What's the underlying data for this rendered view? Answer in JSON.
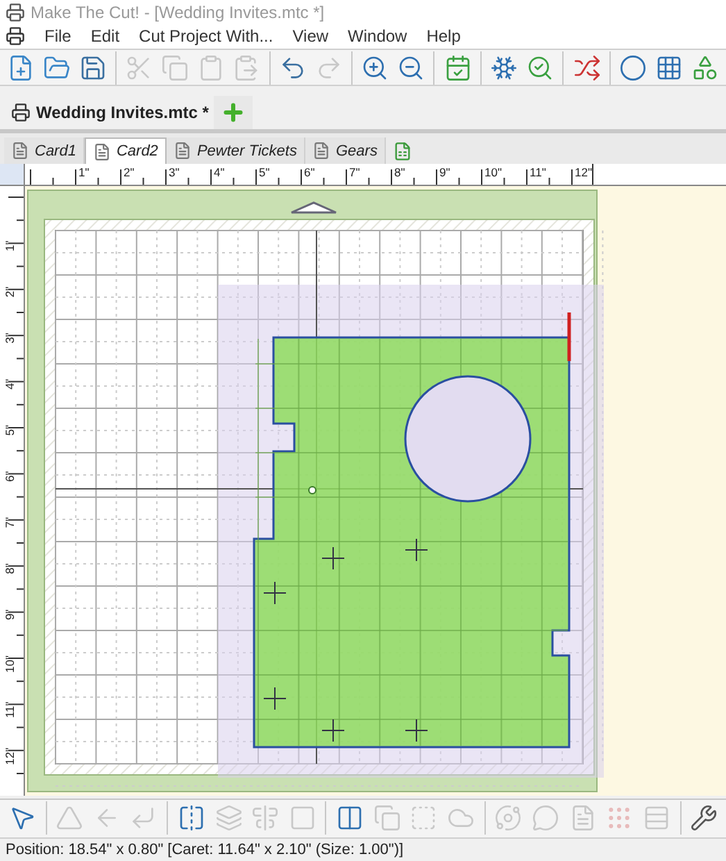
{
  "window": {
    "title": "Make The Cut! - [Wedding Invites.mtc *]"
  },
  "menu": [
    "File",
    "Edit",
    "Cut Project With...",
    "View",
    "Window",
    "Help"
  ],
  "toolbar": [
    {
      "disabled": false
    },
    {
      "disabled": false
    },
    {
      "disabled": false
    },
    {
      "disabled": true
    },
    {
      "disabled": true
    },
    {
      "disabled": true
    },
    {
      "disabled": true
    },
    {
      "disabled": false
    },
    {
      "disabled": true
    },
    {
      "disabled": false
    },
    {
      "disabled": false
    },
    {
      "disabled": false
    },
    {
      "disabled": false
    },
    {
      "disabled": false
    },
    {
      "disabled": false
    },
    {
      "disabled": false
    },
    {
      "disabled": false
    },
    {
      "disabled": false
    }
  ],
  "document_tab": {
    "label": "Wedding Invites.mtc *"
  },
  "page_tabs": [
    {
      "label": "Card1",
      "selected": false
    },
    {
      "label": "Card2",
      "selected": true
    },
    {
      "label": "Pewter Tickets",
      "selected": false
    },
    {
      "label": "Gears",
      "selected": false
    }
  ],
  "ruler": {
    "horizontal": [
      "1\"",
      "2\"",
      "3\"",
      "4\"",
      "5\"",
      "6\"",
      "7\"",
      "8\"",
      "9\"",
      "10\"",
      "11\"",
      "12\""
    ],
    "vertical": [
      "1\"",
      "2\"",
      "3\"",
      "4\"",
      "5\"",
      "6\"",
      "7\"",
      "8\"",
      "9\"",
      "10\"",
      "11\"",
      "12\""
    ]
  },
  "bottom_toolbar": [
    {
      "disabled": false
    },
    {
      "disabled": true
    },
    {
      "disabled": true
    },
    {
      "disabled": true
    },
    {
      "disabled": false
    },
    {
      "disabled": true
    },
    {
      "disabled": true
    },
    {
      "disabled": true
    },
    {
      "disabled": false
    },
    {
      "disabled": true
    },
    {
      "disabled": true
    },
    {
      "disabled": true
    },
    {
      "disabled": true
    },
    {
      "disabled": true
    },
    {
      "disabled": true
    },
    {
      "disabled": true
    },
    {
      "disabled": true
    },
    {
      "disabled": false
    }
  ],
  "status_bar": "Position: 18.54\" x 0.80\" [Caret: 11.64\" x 2.10\" (Size: 1.00\")]"
}
